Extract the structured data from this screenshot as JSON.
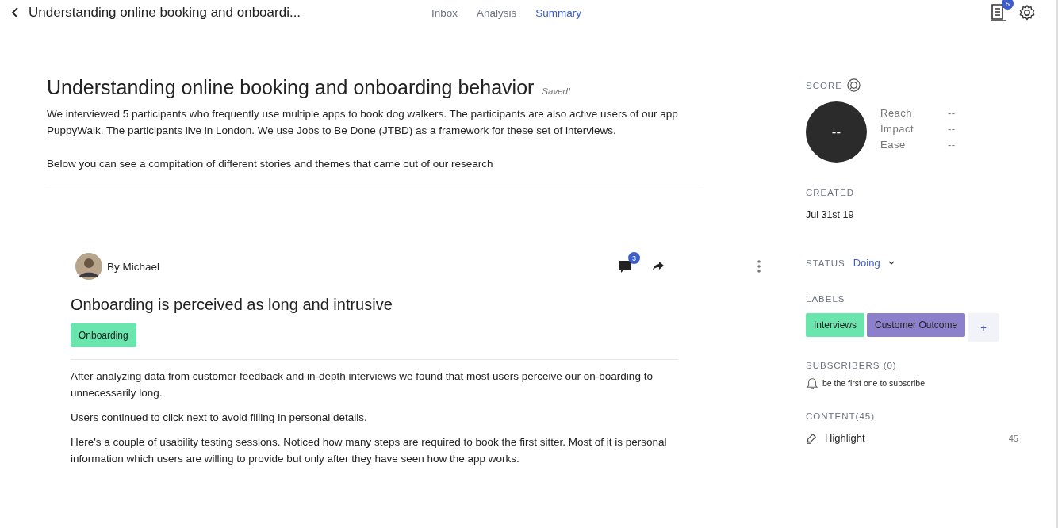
{
  "header": {
    "title": "Understanding online booking and onboardi...",
    "tabs": [
      {
        "label": "Inbox",
        "selected": false
      },
      {
        "label": "Analysis",
        "selected": false
      },
      {
        "label": "Summary",
        "selected": true
      }
    ],
    "notifications_badge": "5"
  },
  "summary": {
    "title": "Understanding online booking and onboarding behavior",
    "saved": "Saved!",
    "paragraphs": [
      "We interviewed 5 participants who frequently use multiple apps to book dog walkers. The participants are also active users of our app PuppyWalk. The participants live in  London. We use Jobs to Be Done (JTBD) as a framework for these set of interviews.",
      "Below you can see a compitation of different stories and themes that came out of our research"
    ]
  },
  "story": {
    "author": "By Michael",
    "comments_badge": "3",
    "title": "Onboarding is perceived as long and intrusive",
    "tags": [
      {
        "label": "Onboarding",
        "color": "#6ae5ad"
      }
    ],
    "paragraphs": [
      "After analyzing data from customer feedback and in-depth interviews we found that most users perceive our on-boarding to unnecessarily long.",
      "Users continued to click next to avoid filling in personal details.",
      "Here's a couple of usability testing sessions. Noticed how many steps are required to book the first sitter. Most of it is personal information which users are willing to provide but only after they have seen how the app works."
    ]
  },
  "sidebar": {
    "score": {
      "heading": "SCORE",
      "value": "--",
      "metrics": [
        {
          "label": "Reach",
          "value": "--"
        },
        {
          "label": "Impact",
          "value": "--"
        },
        {
          "label": "Ease",
          "value": "--"
        }
      ]
    },
    "created": {
      "heading": "CREATED",
      "value": "Jul 31st 19"
    },
    "status": {
      "heading": "STATUS",
      "value": "Doing"
    },
    "labels": {
      "heading": "LABELS",
      "items": [
        {
          "label": "Interviews",
          "color": "#6ae5ad"
        },
        {
          "label": "Customer Outcome",
          "color": "#8c80cc"
        }
      ],
      "add": "+"
    },
    "subscribers": {
      "heading": "SUBSCRIBERS (0)",
      "hint": "be the first one to subscribe"
    },
    "content": {
      "heading": "CONTENT(45)",
      "items": [
        {
          "label": "Highlight",
          "count": "45"
        }
      ]
    }
  }
}
